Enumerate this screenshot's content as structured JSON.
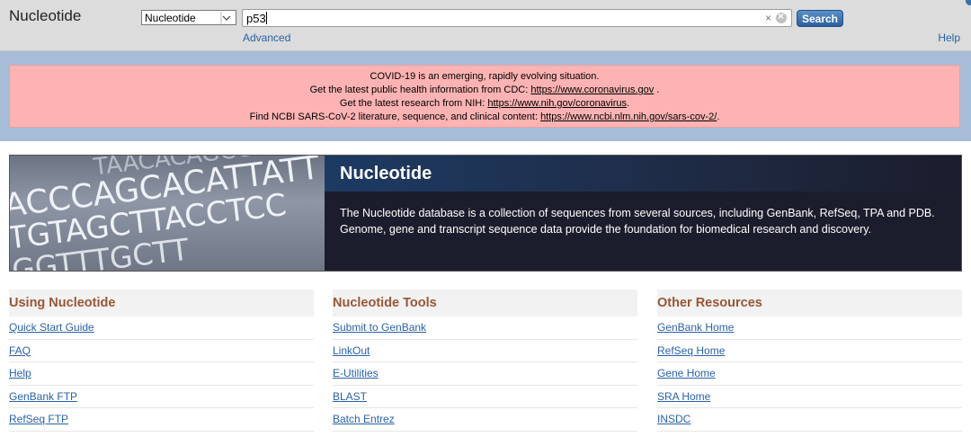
{
  "header": {
    "app_title": "Nucleotide",
    "db_selected": "Nucleotide",
    "search_value": "p53",
    "search_button": "Search",
    "advanced_link": "Advanced",
    "help_link": "Help"
  },
  "alert": {
    "line1": "COVID-19 is an emerging, rapidly evolving situation.",
    "line2_text": "Get the latest public health information from CDC: ",
    "line2_link": "https://www.coronavirus.gov",
    "line2_end": " .",
    "line3_text": "Get the latest research from NIH: ",
    "line3_link": "https://www.nih.gov/coronavirus",
    "line3_end": ".",
    "line4_text": "Find NCBI SARS-CoV-2 literature, sequence, and clinical content: ",
    "line4_link": "https://www.ncbi.nlm.nih.gov/sars-cov-2/",
    "line4_end": "."
  },
  "hero": {
    "title": "Nucleotide",
    "description": "The Nucleotide database is a collection of sequences from several sources, including GenBank, RefSeq, TPA and PDB. Genome, gene and transcript sequence data provide the foundation for biomedical research and discovery.",
    "image_rows": [
      "ACCCAGCACATTATT",
      "TGTAGCTTACCTCC",
      "GGTTTGCTT",
      "TAACACAGCCTA"
    ]
  },
  "columns": [
    {
      "heading": "Using Nucleotide",
      "links": [
        "Quick Start Guide",
        "FAQ",
        "Help",
        "GenBank FTP",
        "RefSeq FTP"
      ]
    },
    {
      "heading": "Nucleotide Tools",
      "links": [
        "Submit to GenBank",
        "LinkOut",
        "E-Utilities",
        "BLAST",
        "Batch Entrez"
      ]
    },
    {
      "heading": "Other Resources",
      "links": [
        "GenBank Home",
        "RefSeq Home",
        "Gene Home",
        "SRA Home",
        "INSDC"
      ]
    }
  ],
  "colors": {
    "link": "#2a61a8",
    "heading": "#985735",
    "alert_bg": "#fdb3b3",
    "search_button": "#2b5f9e"
  }
}
